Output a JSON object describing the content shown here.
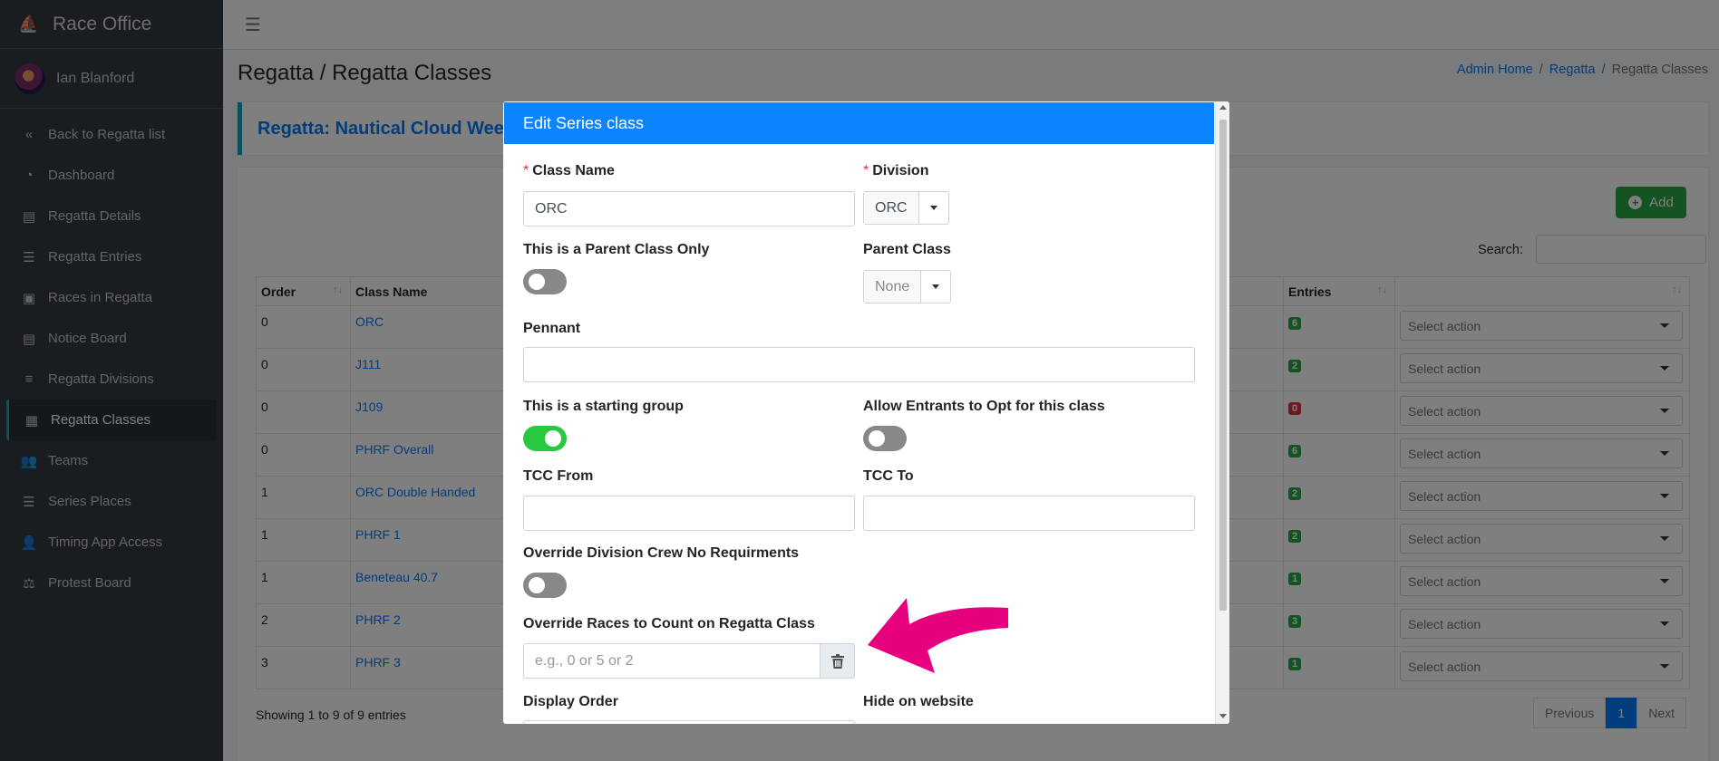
{
  "app": {
    "title": "Race Office"
  },
  "user": {
    "name": "Ian Blanford"
  },
  "sidebar": {
    "items": [
      {
        "label": "Back to Regatta list",
        "icon": "«"
      },
      {
        "label": "Dashboard",
        "icon": "◔"
      },
      {
        "label": "Regatta Details",
        "icon": "▤"
      },
      {
        "label": "Regatta Entries",
        "icon": "☰"
      },
      {
        "label": "Races in Regatta",
        "icon": "▣"
      },
      {
        "label": "Notice Board",
        "icon": "▤"
      },
      {
        "label": "Regatta Divisions",
        "icon": "≡"
      },
      {
        "label": "Regatta Classes",
        "icon": "▦"
      },
      {
        "label": "Teams",
        "icon": "👥"
      },
      {
        "label": "Series Places",
        "icon": "☰"
      },
      {
        "label": "Timing App Access",
        "icon": "👤"
      },
      {
        "label": "Protest Board",
        "icon": "⚖"
      }
    ]
  },
  "page": {
    "title": "Regatta / Regatta Classes",
    "breadcrumb": [
      "Admin Home",
      "Regatta",
      "Regatta Classes"
    ],
    "regatta_label": "Regatta: Nautical Cloud Wee"
  },
  "toolbar": {
    "add_label": "Add",
    "search_label": "Search:"
  },
  "table": {
    "headers": {
      "order": "Order",
      "class_name": "Class Name",
      "entries": "Entries"
    },
    "select_placeholder": "Select action",
    "rows": [
      {
        "order": "0",
        "name": "ORC",
        "entries": "6",
        "color": "green"
      },
      {
        "order": "0",
        "name": "J111",
        "entries": "2",
        "color": "green"
      },
      {
        "order": "0",
        "name": "J109",
        "entries": "0",
        "color": "red"
      },
      {
        "order": "0",
        "name": "PHRF Overall",
        "entries": "6",
        "color": "green"
      },
      {
        "order": "1",
        "name": "ORC Double Handed",
        "entries": "2",
        "color": "green"
      },
      {
        "order": "1",
        "name": "PHRF 1",
        "entries": "2",
        "color": "green"
      },
      {
        "order": "1",
        "name": "Beneteau 40.7",
        "entries": "1",
        "color": "green"
      },
      {
        "order": "2",
        "name": "PHRF 2",
        "entries": "3",
        "color": "green"
      },
      {
        "order": "3",
        "name": "PHRF 3",
        "entries": "1",
        "color": "green"
      }
    ],
    "info": "Showing 1 to 9 of 9 entries",
    "pager": {
      "prev": "Previous",
      "page": "1",
      "next": "Next"
    }
  },
  "modal": {
    "title": "Edit Series class",
    "class_name_label": "Class Name",
    "class_name_value": "ORC",
    "division_label": "Division",
    "division_value": "ORC",
    "parent_only_label": "This is a Parent Class Only",
    "parent_class_label": "Parent Class",
    "parent_class_value": "None",
    "pennant_label": "Pennant",
    "starting_group_label": "This is a starting group",
    "allow_opt_label": "Allow Entrants to Opt for this class",
    "tcc_from_label": "TCC From",
    "tcc_to_label": "TCC To",
    "override_crew_label": "Override Division Crew No Requirments",
    "override_races_label": "Override Races to Count on Regatta Class",
    "override_races_placeholder": "e.g., 0 or 5 or 2",
    "display_order_label": "Display Order",
    "hide_website_label": "Hide on website",
    "toggles": {
      "parent_only": false,
      "starting_group": true,
      "allow_opt": false,
      "override_crew": false
    }
  },
  "colors": {
    "accent": "#007bff",
    "modal_header": "#0a84ff",
    "annotation_arrow": "#e6007e",
    "toggle_on": "#28c840"
  }
}
